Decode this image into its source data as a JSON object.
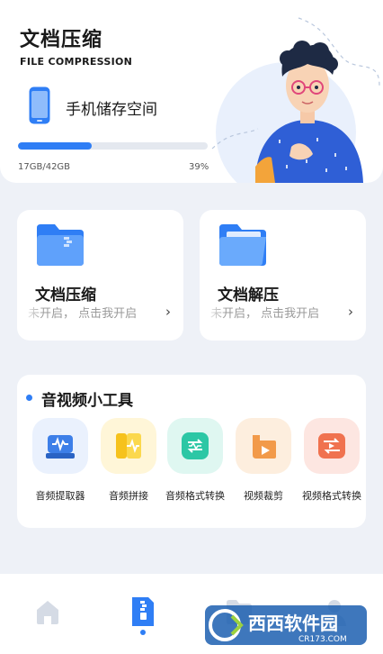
{
  "header": {
    "title": "文档压缩",
    "subtitle": "FILE COMPRESSION",
    "storage_label": "手机储存空间",
    "storage_used": "17GB/42GB",
    "storage_percent": "39%",
    "storage_fraction": 0.39
  },
  "features": [
    {
      "title": "文档压缩",
      "status": "未开启， 点击我开启"
    },
    {
      "title": "文档解压",
      "status": "未开启， 点击我开启"
    }
  ],
  "tools": {
    "title": "音视频小工具",
    "items": [
      {
        "label": "音频提取器",
        "icon": "audio-extract-icon"
      },
      {
        "label": "音频拼接",
        "icon": "audio-merge-icon"
      },
      {
        "label": "音频格式转换",
        "icon": "audio-convert-icon"
      },
      {
        "label": "视频裁剪",
        "icon": "video-crop-icon"
      },
      {
        "label": "视频格式转换",
        "icon": "video-convert-icon"
      }
    ]
  },
  "nav": {
    "items": [
      "home-icon",
      "compress-doc-icon",
      "folder-icon",
      "profile-icon"
    ],
    "active_index": 1
  },
  "watermark": {
    "brand": "西西软件园",
    "url": "CR173.COM"
  },
  "colors": {
    "accent": "#2f7ef5",
    "background": "#eef1f7"
  }
}
